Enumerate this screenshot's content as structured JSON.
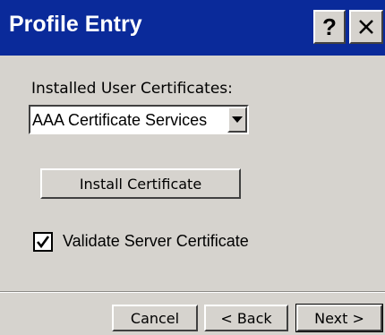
{
  "window": {
    "title": "Profile Entry",
    "help_label": "?",
    "close_icon": "close-icon",
    "titlebar_color": "#0a2a9a"
  },
  "certificates": {
    "label": "Installed User Certificates:",
    "selected": "AAA Certificate Services",
    "dropdown_icon": "chevron-down-icon"
  },
  "install_button": {
    "label": "Install Certificate"
  },
  "validate": {
    "label": "Validate Server Certificate",
    "checked": true
  },
  "footer": {
    "cancel_label": "Cancel",
    "back_label": "< Back",
    "next_label": "Next >"
  }
}
